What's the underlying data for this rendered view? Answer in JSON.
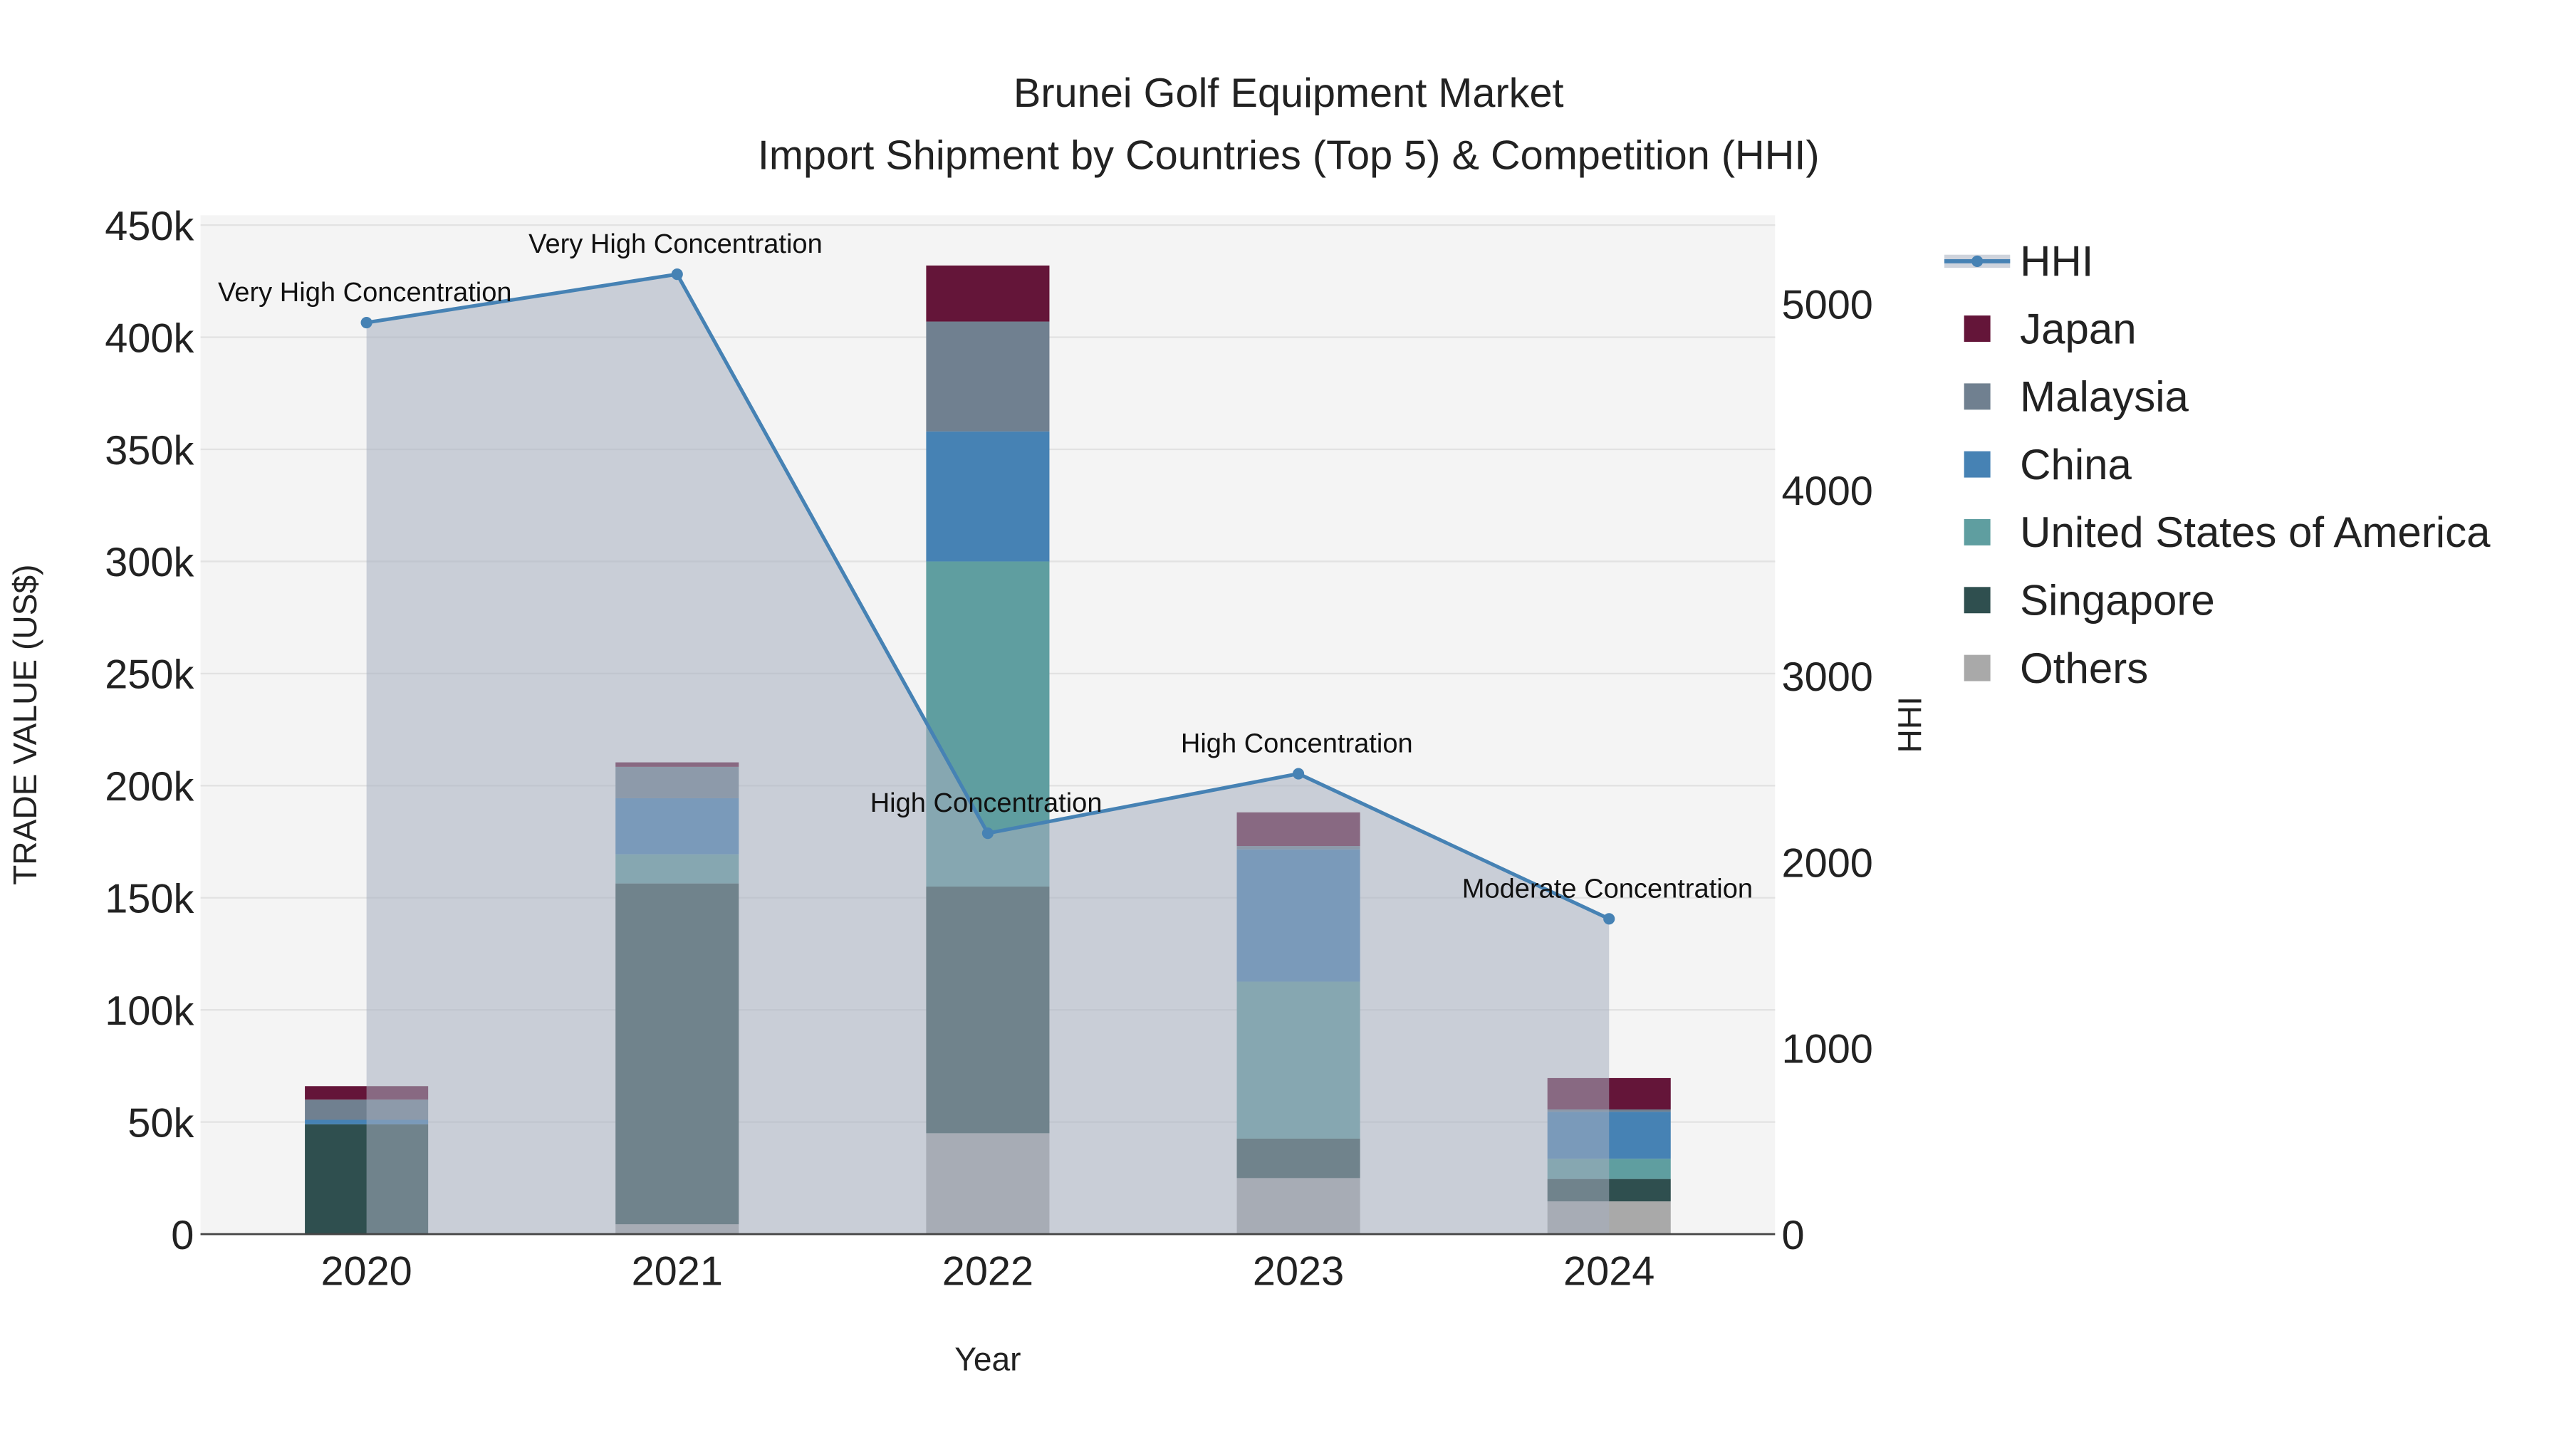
{
  "chart_data": {
    "type": "bar",
    "title": "Brunei Golf Equipment Market",
    "subtitle": "Import Shipment by Countries (Top 5) & Competition (HHI)",
    "xlabel": "Year",
    "ylabel": "TRADE VALUE (US$)",
    "y2label": "HHI",
    "categories": [
      "2020",
      "2021",
      "2022",
      "2023",
      "2024"
    ],
    "ylim": [
      0,
      450000
    ],
    "y2lim": [
      0,
      5450
    ],
    "yticks": [
      0,
      50000,
      100000,
      150000,
      200000,
      250000,
      300000,
      350000,
      400000,
      450000
    ],
    "ytick_labels": [
      "0",
      "50k",
      "100k",
      "150k",
      "200k",
      "250k",
      "300k",
      "350k",
      "400k",
      "450k"
    ],
    "y2ticks": [
      0,
      1000,
      2000,
      3000,
      4000,
      5000
    ],
    "y2tick_labels": [
      "0",
      "1000",
      "2000",
      "3000",
      "4000",
      "5000"
    ],
    "legend_position": "right",
    "series": [
      {
        "name": "Others",
        "color": "#a9a9a9",
        "values": [
          0,
          4400,
          45000,
          25000,
          14600
        ]
      },
      {
        "name": "Singapore",
        "color": "#2f4f4f",
        "values": [
          49000,
          152000,
          110000,
          17600,
          10000
        ]
      },
      {
        "name": "United States of America",
        "color": "#5f9ea0",
        "values": [
          0,
          13000,
          145000,
          70000,
          9000
        ]
      },
      {
        "name": "China",
        "color": "#4682b4",
        "values": [
          2000,
          25000,
          58000,
          59000,
          21000
        ]
      },
      {
        "name": "Malaysia",
        "color": "#708090",
        "values": [
          9000,
          14000,
          49000,
          1500,
          1000
        ]
      },
      {
        "name": "Japan",
        "color": "#641539",
        "values": [
          6000,
          2000,
          25000,
          15000,
          14000
        ]
      }
    ],
    "hhi": {
      "name": "HHI",
      "color": "#4682b4",
      "values": [
        4900,
        5160,
        2155,
        2475,
        1695
      ],
      "annotations": [
        "Very High Concentration",
        "Very High Concentration",
        "High Concentration",
        "High Concentration",
        "Moderate Concentration"
      ]
    },
    "legend_order": [
      "HHI",
      "Japan",
      "Malaysia",
      "China",
      "United States of America",
      "Singapore",
      "Others"
    ]
  }
}
